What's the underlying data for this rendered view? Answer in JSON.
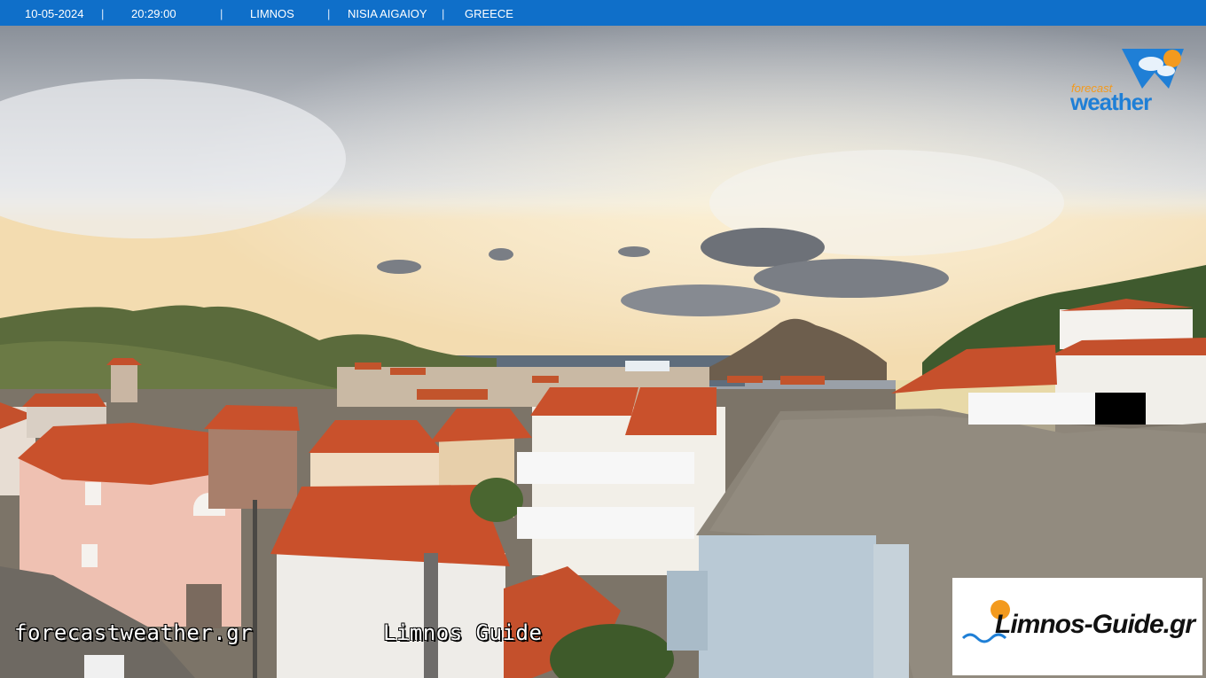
{
  "header": {
    "date": "10-05-2024",
    "time": "20:29:00",
    "location": "LIMNOS",
    "region": "NISIA AIGAIOY",
    "country": "GREECE",
    "separator": "|",
    "bar_color": "#0f6fc9"
  },
  "logos": {
    "forecast_small": "forecast",
    "forecast_big": "weather",
    "guide": "Limnos-Guide.gr"
  },
  "overlays": {
    "left_watermark": "forecastweather.gr",
    "center_watermark": "Limnos Guide"
  },
  "icons": {
    "sun": "sun-icon",
    "wave": "wave-icon"
  }
}
